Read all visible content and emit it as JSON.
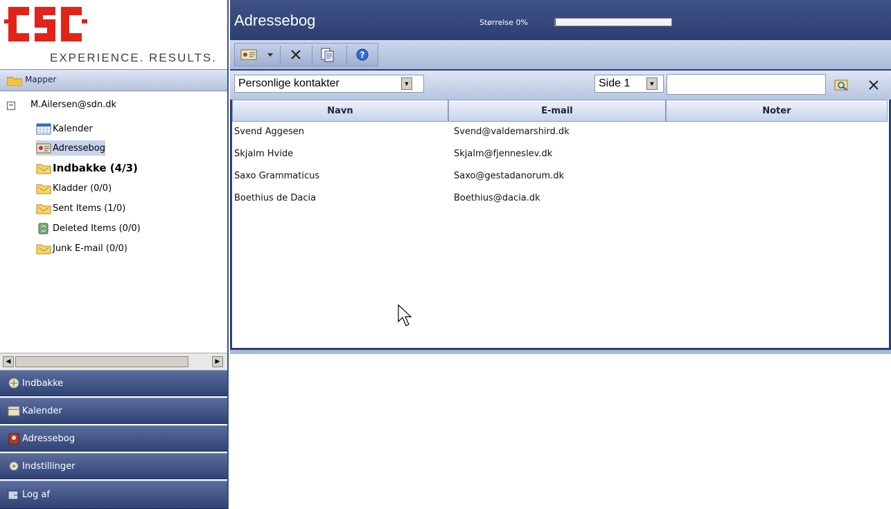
{
  "brand": {
    "logo_text": "CSC",
    "tagline": "EXPERIENCE. RESULTS.",
    "logo_color": "#e2231a"
  },
  "folders_panel": {
    "header_label": "Mapper",
    "account": "M.Ailersen@sdn.dk",
    "account_toggle": "−",
    "items": [
      {
        "label": "Kalender",
        "icon": "calendar-icon",
        "bold": false
      },
      {
        "label": "Adressebog",
        "icon": "contacts-icon",
        "bold": false,
        "selected": true
      },
      {
        "label": "Indbakke (4/3)",
        "icon": "folder-icon",
        "bold": true
      },
      {
        "label": "Kladder (0/0)",
        "icon": "folder-icon",
        "bold": false
      },
      {
        "label": "Sent Items (1/0)",
        "icon": "folder-icon",
        "bold": false
      },
      {
        "label": "Deleted Items (0/0)",
        "icon": "recycle-icon",
        "bold": false
      },
      {
        "label": "Junk E-mail (0/0)",
        "icon": "folder-icon",
        "bold": false
      }
    ]
  },
  "nav_buttons": [
    {
      "label": "Indbakke",
      "icon": "inbox-icon"
    },
    {
      "label": "Kalender",
      "icon": "calendar-icon"
    },
    {
      "label": "Adressebog",
      "icon": "addressbook-icon"
    },
    {
      "label": "Indstillinger",
      "icon": "settings-icon"
    },
    {
      "label": "Log af",
      "icon": "logoff-icon"
    }
  ],
  "header": {
    "title": "Adressebog",
    "size_label": "Størrelse 0%",
    "size_percent": 0
  },
  "toolbar": {
    "buttons": [
      "new-contact-icon",
      "dropdown-arrow-icon",
      "delete-icon",
      "move-icon",
      "help-icon"
    ]
  },
  "filter": {
    "contact_list": "Personlige kontakter",
    "page": "Side 1",
    "search_value": ""
  },
  "table": {
    "columns": [
      "Navn",
      "E-mail",
      "Noter"
    ],
    "rows": [
      {
        "name": "Svend Aggesen",
        "email": "Svend@valdemarshird.dk",
        "notes": ""
      },
      {
        "name": "Skjalm Hvide",
        "email": "Skjalm@fjenneslev.dk",
        "notes": ""
      },
      {
        "name": "Saxo Grammaticus",
        "email": "Saxo@gestadanorum.dk",
        "notes": ""
      },
      {
        "name": "Boethius de Dacia",
        "email": "Boethius@dacia.dk",
        "notes": ""
      }
    ]
  }
}
